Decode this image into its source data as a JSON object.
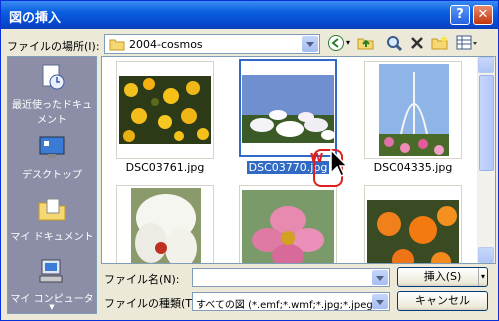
{
  "title": "図の挿入",
  "lookin": {
    "label": "ファイルの場所(I):",
    "value": "2004-cosmos"
  },
  "places": [
    {
      "label": "最近使ったドキュメント",
      "icon": "recent-documents-icon"
    },
    {
      "label": "デスクトップ",
      "icon": "desktop-icon"
    },
    {
      "label": "マイ ドキュメント",
      "icon": "my-documents-icon"
    },
    {
      "label": "マイ コンピュータ",
      "icon": "my-computer-icon"
    }
  ],
  "files": [
    {
      "name": "DSC03761.jpg",
      "selected": false
    },
    {
      "name": "DSC03770.jpg",
      "selected": true
    },
    {
      "name": "DSC04335.jpg",
      "selected": false
    },
    {
      "name": "",
      "selected": false
    },
    {
      "name": "",
      "selected": false
    },
    {
      "name": "",
      "selected": false
    }
  ],
  "filename": {
    "label": "ファイル名(N):",
    "value": ""
  },
  "filetype": {
    "label": "ファイルの種類(T):",
    "value": "すべての図 (*.emf;*.wmf;*.jpg;*.jpeg;"
  },
  "buttons": {
    "insert": "挿入(S)",
    "cancel": "キャンセル"
  },
  "cursor_badge": "W"
}
